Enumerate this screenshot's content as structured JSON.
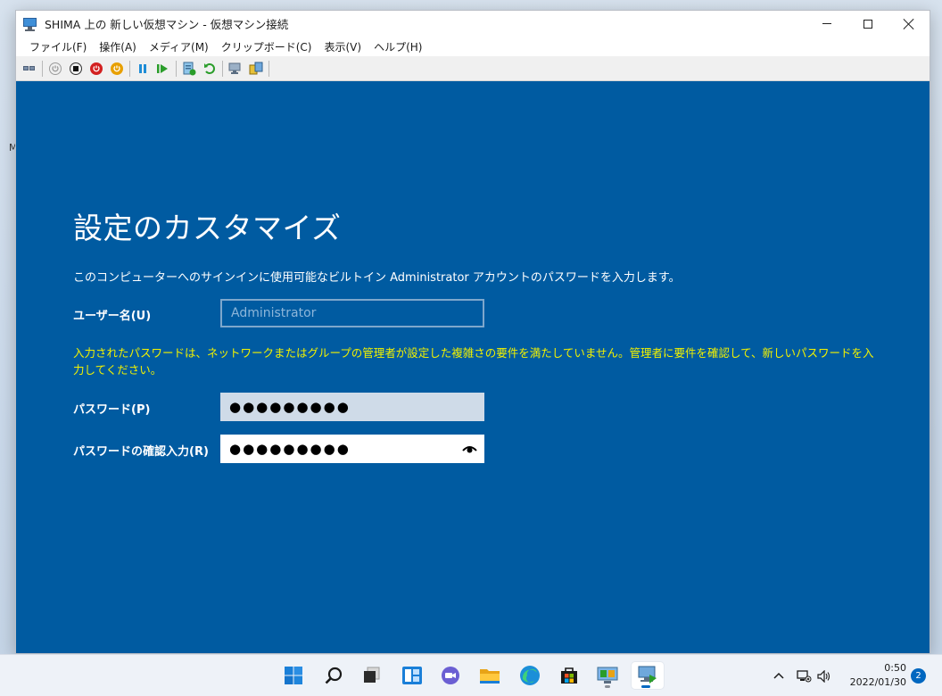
{
  "window": {
    "title": "SHIMA 上の 新しい仮想マシン - 仮想マシン接続"
  },
  "menu": {
    "items": [
      "ファイル(F)",
      "操作(A)",
      "メディア(M)",
      "クリップボード(C)",
      "表示(V)",
      "ヘルプ(H)"
    ]
  },
  "toolbar": {
    "icons": [
      "ctrl-alt-del-icon",
      "start-icon",
      "turn-off-icon",
      "shutdown-icon",
      "save-icon",
      "pause-icon",
      "resume-icon",
      "checkpoint-icon",
      "revert-icon",
      "enhanced-session-icon",
      "share-icon"
    ]
  },
  "vm": {
    "title": "設定のカスタマイズ",
    "description": "このコンピューターへのサインインに使用可能なビルトイン Administrator アカウントのパスワードを入力します。",
    "username_label": "ユーザー名(U)",
    "username_placeholder": "Administrator",
    "warning": "入力されたパスワードは、ネットワークまたはグループの管理者が設定した複雑さの要件を満たしていません。管理者に要件を確認して、新しいパスワードを入力してください。",
    "password_label": "パスワード(P)",
    "password_value": "●●●●●●●●●",
    "confirm_label": "パスワードの確認入力(R)",
    "confirm_value": "●●●●●●●●●",
    "background_color": "#005ba1",
    "warning_color": "#f2f200"
  },
  "desktop": {
    "edge_fragment": "M"
  },
  "taskbar": {
    "apps": [
      "start-icon",
      "search-icon",
      "task-view-icon",
      "widgets-icon",
      "teams-chat-icon",
      "file-explorer-icon",
      "edge-icon",
      "store-icon",
      "hyperv-manager-icon",
      "vm-connection-icon"
    ],
    "time": "0:50",
    "date": "2022/01/30",
    "notification_count": "2"
  }
}
